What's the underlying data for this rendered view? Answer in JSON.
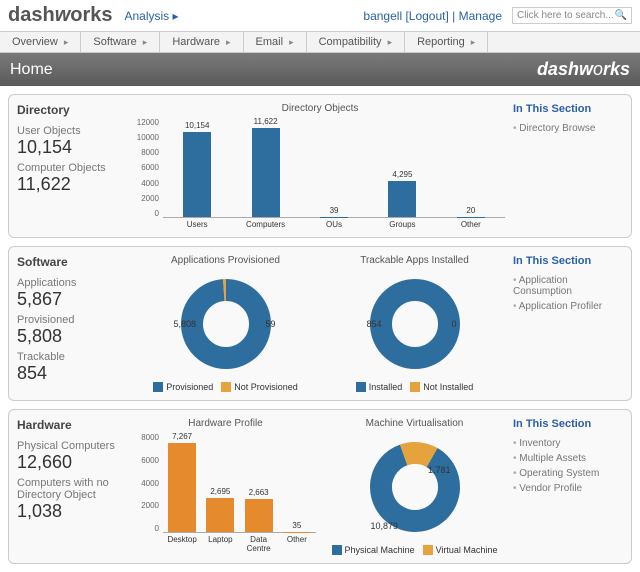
{
  "brand": "dashworks",
  "analysis_label": "Analysis",
  "user": "bangell",
  "logout": "[Logout]",
  "manage": "Manage",
  "search_placeholder": "Click here to search...",
  "nav": [
    "Overview",
    "Software",
    "Hardware",
    "Email",
    "Compatibility",
    "Reporting"
  ],
  "page_title": "Home",
  "in_section": "In This Section",
  "directory": {
    "title": "Directory",
    "stats": [
      {
        "label": "User Objects",
        "value": "10,154"
      },
      {
        "label": "Computer Objects",
        "value": "11,622"
      }
    ],
    "links": [
      "Directory Browse"
    ],
    "chart_title": "Directory Objects"
  },
  "software": {
    "title": "Software",
    "stats": [
      {
        "label": "Applications",
        "value": "5,867"
      },
      {
        "label": "Provisioned",
        "value": "5,808"
      },
      {
        "label": "Trackable",
        "value": "854"
      }
    ],
    "links": [
      "Application Consumption",
      "Application Profiler"
    ],
    "chart1_title": "Applications Provisioned",
    "chart2_title": "Trackable Apps Installed",
    "legend1": [
      "Provisioned",
      "Not Provisioned"
    ],
    "legend2": [
      "Installed",
      "Not Installed"
    ],
    "donut1": {
      "a": "5,808",
      "b": "59"
    },
    "donut2": {
      "a": "854",
      "b": "0"
    }
  },
  "hardware": {
    "title": "Hardware",
    "stats": [
      {
        "label": "Physical Computers",
        "value": "12,660"
      },
      {
        "label": "Computers with no Directory Object",
        "value": "1,038"
      }
    ],
    "links": [
      "Inventory",
      "Multiple Assets",
      "Operating System",
      "Vendor Profile"
    ],
    "chart1_title": "Hardware Profile",
    "chart2_title": "Machine Virtualisation",
    "legend2": [
      "Physical Machine",
      "Virtual Machine"
    ],
    "donut": {
      "a": "10,879",
      "b": "1,781"
    }
  },
  "chart_data": [
    {
      "type": "bar",
      "title": "Directory Objects",
      "categories": [
        "Users",
        "Computers",
        "OUs",
        "Groups",
        "Other"
      ],
      "values": [
        10154,
        11622,
        39,
        4295,
        20
      ],
      "ylim": [
        0,
        12000
      ],
      "yticks": [
        0,
        2000,
        4000,
        6000,
        8000,
        10000,
        12000
      ],
      "color": "#2e6e9e"
    },
    {
      "type": "pie",
      "title": "Applications Provisioned",
      "series": [
        {
          "name": "Provisioned",
          "value": 5808
        },
        {
          "name": "Not Provisioned",
          "value": 59
        }
      ],
      "colors": [
        "#2e6e9e",
        "#e6a23c"
      ]
    },
    {
      "type": "pie",
      "title": "Trackable Apps Installed",
      "series": [
        {
          "name": "Installed",
          "value": 854
        },
        {
          "name": "Not Installed",
          "value": 0
        }
      ],
      "colors": [
        "#2e6e9e",
        "#e6a23c"
      ]
    },
    {
      "type": "bar",
      "title": "Hardware Profile",
      "categories": [
        "Desktop",
        "Laptop",
        "Data Centre",
        "Other"
      ],
      "values": [
        7267,
        2695,
        2663,
        35
      ],
      "ylim": [
        0,
        8000
      ],
      "yticks": [
        0,
        2000,
        4000,
        6000,
        8000
      ],
      "color": "#e68a2e"
    },
    {
      "type": "pie",
      "title": "Machine Virtualisation",
      "series": [
        {
          "name": "Physical Machine",
          "value": 10879
        },
        {
          "name": "Virtual Machine",
          "value": 1781
        }
      ],
      "colors": [
        "#2e6e9e",
        "#e6a23c"
      ]
    }
  ]
}
